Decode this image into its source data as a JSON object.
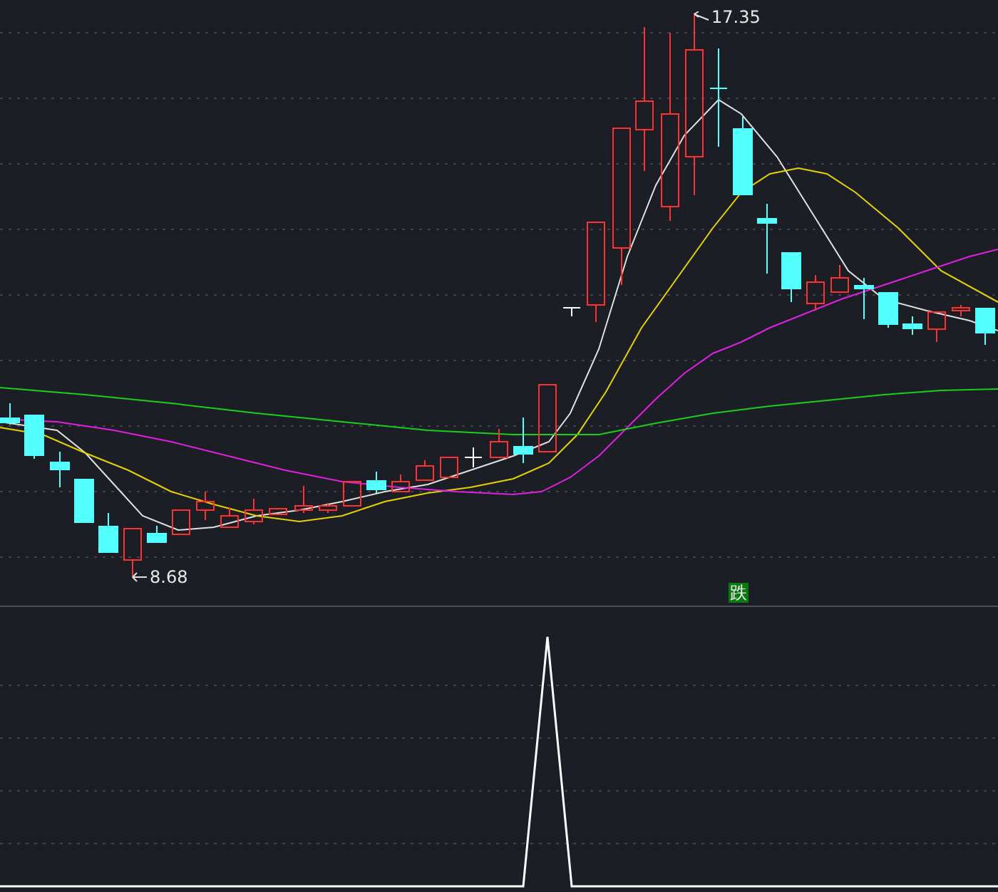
{
  "price_panel": {
    "high_label": "17.35",
    "low_label": "8.68",
    "signal": {
      "label": "跌"
    }
  }
}
